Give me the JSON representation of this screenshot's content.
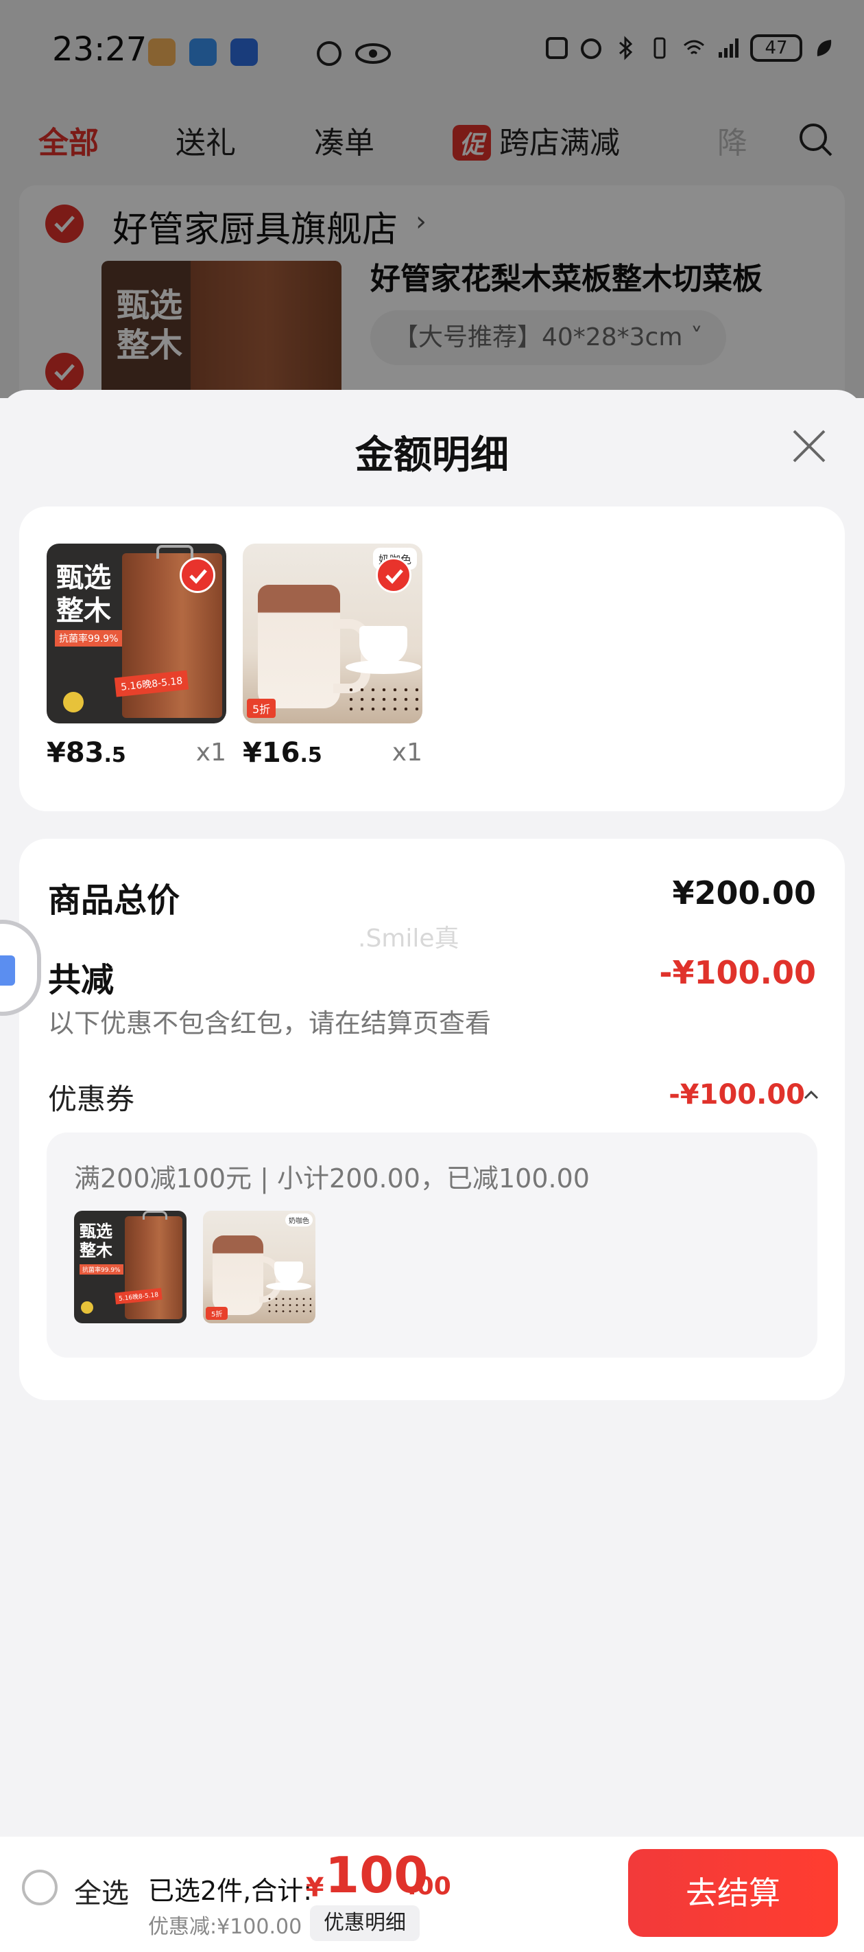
{
  "statusbar": {
    "time": "23:27",
    "battery": "47"
  },
  "tabs": {
    "all": "全部",
    "gift": "送礼",
    "bundle": "凑单",
    "promo_badge": "促",
    "cross_store": "跨店满减",
    "partial": "降"
  },
  "store": {
    "name": "好管家厨具旗舰店",
    "chevron": "›"
  },
  "background_item": {
    "title": "好管家花梨木菜板整木切菜板",
    "variant": "【大号推荐】40*28*3cm ˅",
    "thumb_text": "甄选整木"
  },
  "sheet": {
    "title": "金额明细",
    "products": [
      {
        "price_int": "¥83",
        "price_dec": ".5",
        "qty": "x1",
        "image_text": "甄选整木",
        "image_tag": "抗菌率99.9%",
        "promo": "5.16晚8-5.18"
      },
      {
        "price_int": "¥16",
        "price_dec": ".5",
        "qty": "x1",
        "image_tag": "奶咖色",
        "promo": "5折"
      }
    ],
    "summary": {
      "total_label": "商品总价",
      "total_value": "¥200.00",
      "discount_label": "共减",
      "discount_value": "-¥100.00",
      "discount_note": "以下优惠不包含红包，请在结算页查看",
      "watermark": ".Smile真",
      "coupon_label": "优惠券",
      "coupon_value": "-¥100.00",
      "coupon_desc": "满200减100元 | 小计200.00，已减100.00"
    }
  },
  "bottom_bar": {
    "select_all": "全选",
    "selected_count": "已选2件,合计:",
    "currency": "¥",
    "total_int": "100",
    "total_dec": ".00",
    "discount_note": "优惠减:¥100.00",
    "detail_button": "优惠明细",
    "checkout_button": "去结算"
  },
  "colors": {
    "accent": "#e0322b",
    "checkout": "#ff3d30"
  },
  "icons": [
    "app-icon",
    "message-icon",
    "robot-icon",
    "hd-icon",
    "eye-icon",
    "nfc-icon",
    "alarm-icon",
    "bluetooth-icon",
    "vibrate-icon",
    "wifi-icon",
    "signal-icon",
    "battery-icon",
    "leaf-icon",
    "search-icon",
    "close-icon",
    "check-icon",
    "chevron-up-icon"
  ]
}
